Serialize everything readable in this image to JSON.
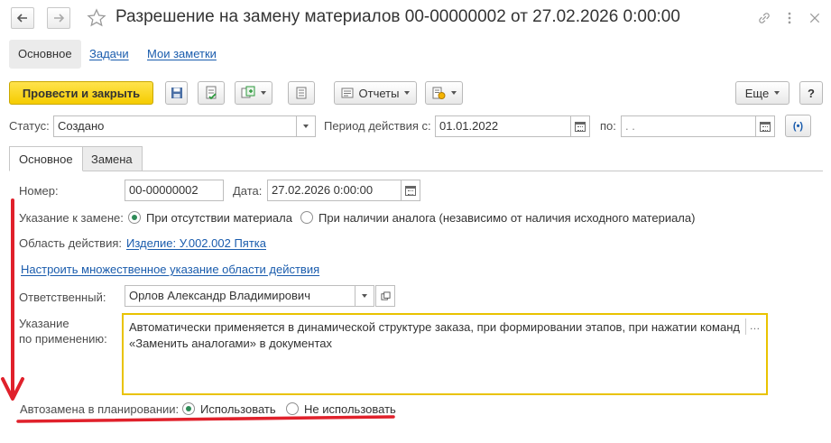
{
  "window": {
    "title": "Разрешение на замену материалов 00-00000002 от 27.02.2026 0:00:00"
  },
  "panel_tabs": {
    "main": "Основное",
    "tasks": "Задачи",
    "notes": "Мои заметки"
  },
  "toolbar": {
    "post_close": "Провести и закрыть",
    "reports": "Отчеты",
    "more": "Еще",
    "help": "?"
  },
  "header": {
    "status_label": "Статус:",
    "status_value": "Создано",
    "period_label": "Период действия с:",
    "period_from": "01.01.2022",
    "period_to_label": "по:",
    "period_to": " .  ."
  },
  "tabs": {
    "main": "Основное",
    "replacement": "Замена"
  },
  "form": {
    "number_label": "Номер:",
    "number_value": "00-00000002",
    "date_label": "Дата:",
    "date_value": "27.02.2026  0:00:00",
    "replace_label": "Указание к замене:",
    "replace_opt1": "При отсутствии материала",
    "replace_opt2": "При наличии аналога (независимо от наличия исходного материала)",
    "scope_label": "Область действия:",
    "scope_link": "Изделие: У.002.002 Пятка",
    "multi_scope_link": "Настроить множественное указание области действия",
    "responsible_label": "Ответственный:",
    "responsible_value": "Орлов Александр Владимирович",
    "apply_label_1": "Указание",
    "apply_label_2": "по применению:",
    "apply_text": "Автоматически применяется в динамической структуре заказа, при формировании этапов, при нажатии команд «Заменить аналогами» в документах",
    "auto_label": "Автозамена в планировании:",
    "auto_opt1": "Использовать",
    "auto_opt2": "Не использовать"
  },
  "colors": {
    "accent_yellow": "#f5cc00",
    "link": "#1a5cad",
    "annotation_red": "#e0212b",
    "radio_green": "#2e8b57"
  }
}
